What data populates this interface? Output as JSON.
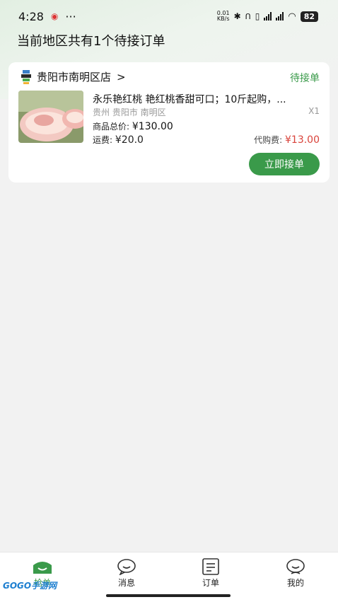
{
  "status_bar": {
    "time": "4:28",
    "more": "···",
    "net_speed_value": "0.01",
    "net_speed_unit": "KB/s",
    "battery": "82"
  },
  "page": {
    "title": "当前地区共有1个待接订单"
  },
  "order": {
    "store_name": "贵阳市南明区店",
    "store_arrow": ">",
    "status": "待接单",
    "product_title": "永乐艳红桃 艳红桃香甜可口；10斤起购，...",
    "location": "贵州 贵阳市 南明区",
    "quantity": "X1",
    "total_label": "商品总价:",
    "total_value": "¥130.00",
    "shipping_label": "运费:",
    "shipping_value": "¥20.0",
    "agent_fee_label": "代购费:",
    "agent_fee_value": "¥13.00",
    "accept_button": "立即接单"
  },
  "tabbar": {
    "tabs": [
      {
        "label": "抢单",
        "icon": "grab-order-icon",
        "active": true
      },
      {
        "label": "消息",
        "icon": "message-icon",
        "active": false
      },
      {
        "label": "订单",
        "icon": "order-list-icon",
        "active": false
      },
      {
        "label": "我的",
        "icon": "profile-icon",
        "active": false
      }
    ]
  },
  "watermark": "GOGO手游网",
  "colors": {
    "accent": "#3a9a4a",
    "price_red": "#d9433b"
  }
}
